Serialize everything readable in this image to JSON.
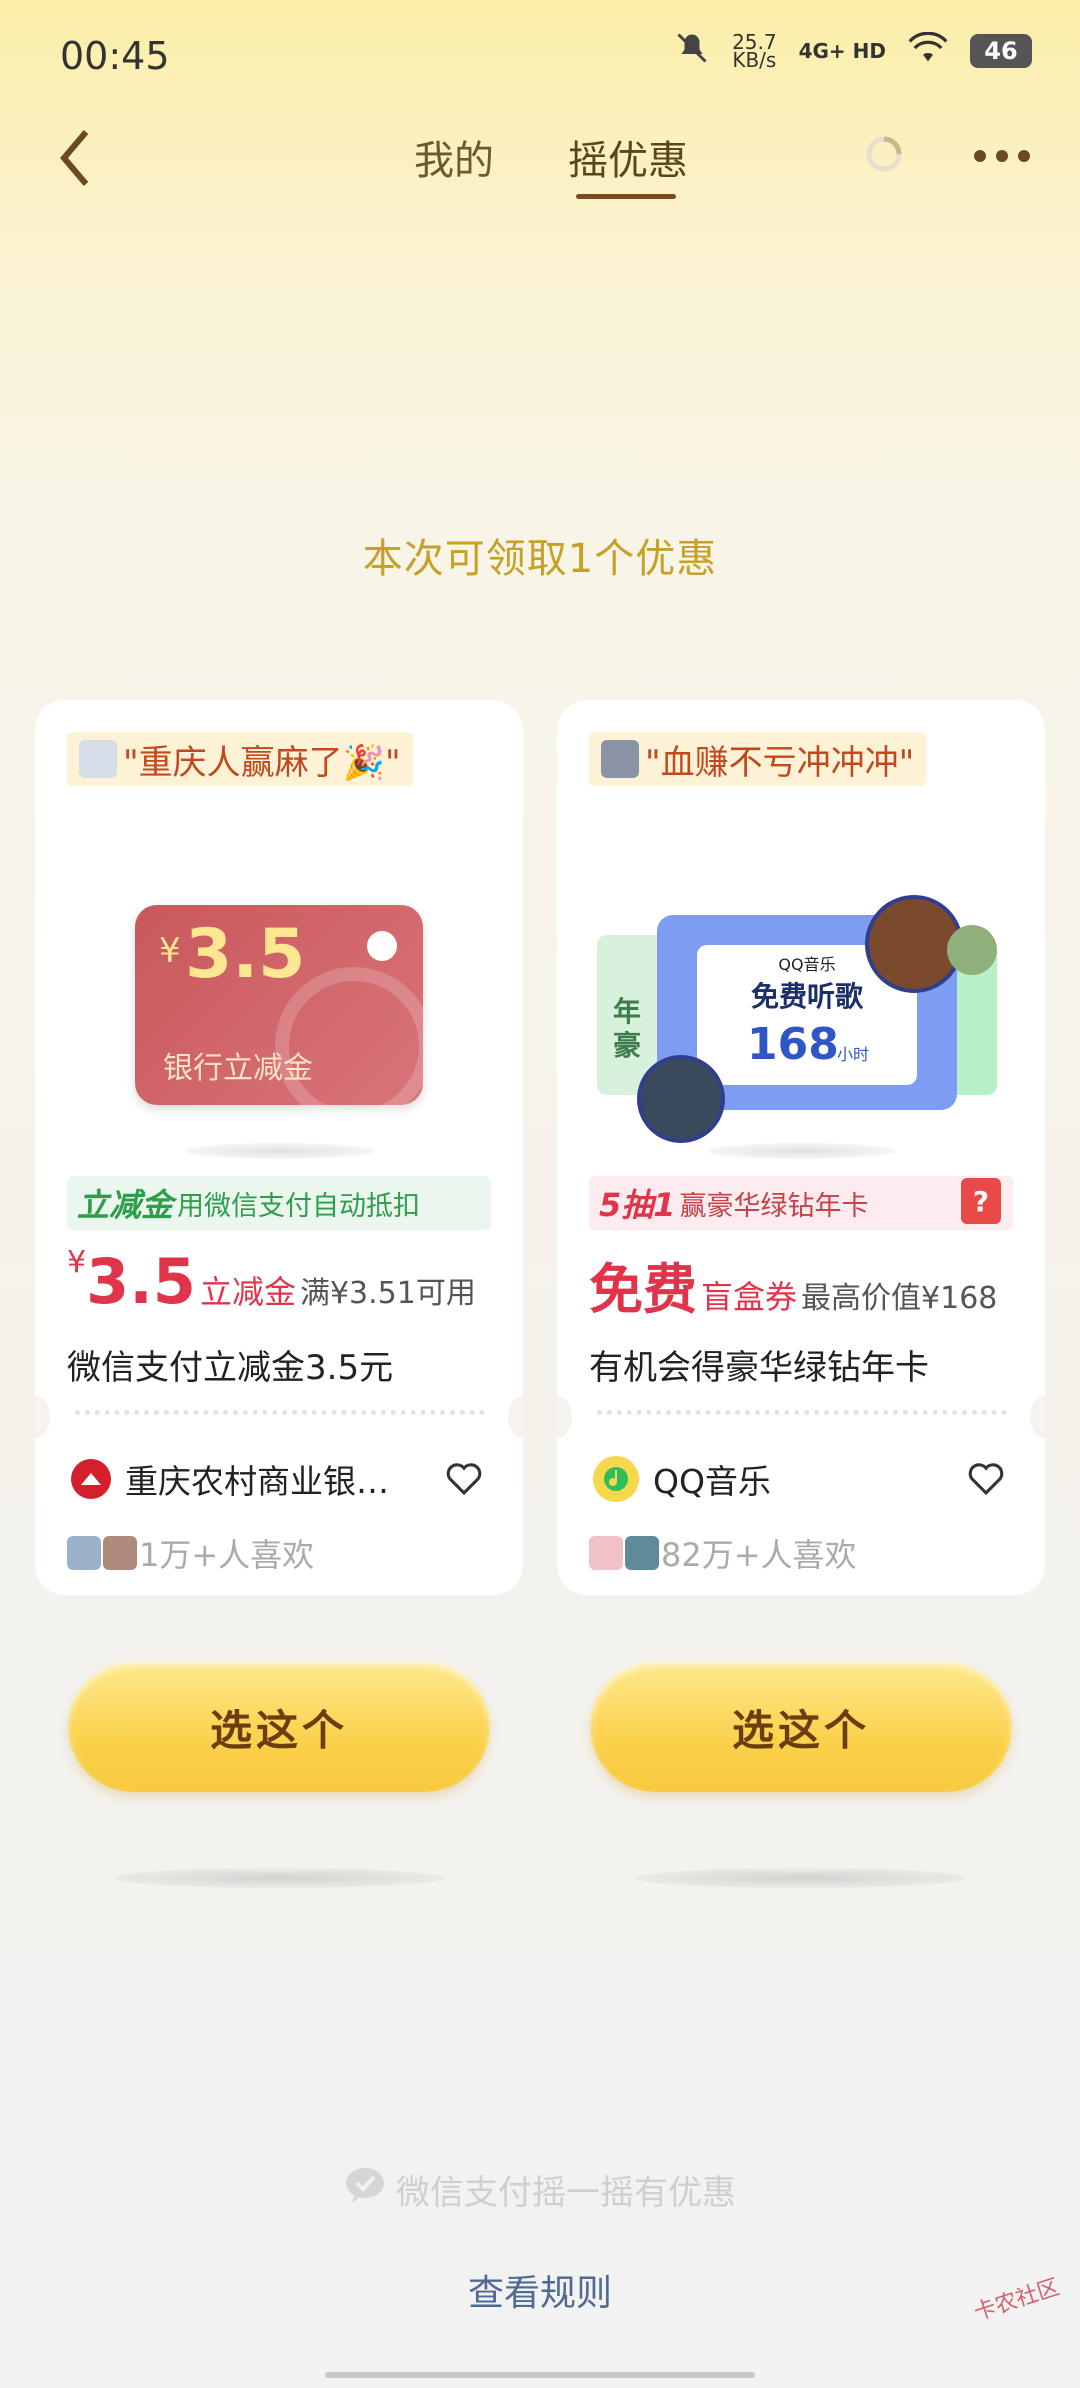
{
  "status_bar": {
    "time": "00:45",
    "net_speed_value": "25.7",
    "net_speed_unit": "KB/s",
    "network": "4G+ HD",
    "battery": "46"
  },
  "nav": {
    "tab_mine": "我的",
    "tab_shake": "摇优惠",
    "active_tab": "摇优惠"
  },
  "headline": "本次可领取1个优惠",
  "cards": [
    {
      "quote": "\"重庆人赢麻了🎉\"",
      "image": {
        "currency": "¥",
        "amount": "3.5",
        "label": "银行立减金"
      },
      "promo_strong": "立减金",
      "promo_text": "用微信支付自动抵扣",
      "price_symbol": "¥",
      "price_value": "3.5",
      "price_type": "立减金",
      "price_note": "满¥3.51可用",
      "title": "微信支付立减金3.5元",
      "brand": "重庆农村商业银…",
      "likes": "1万+人喜欢",
      "button": "选这个"
    },
    {
      "quote": "\"血赚不亏冲冲冲\"",
      "image": {
        "brand": "QQ音乐",
        "headline": "免费听歌",
        "hours": "168",
        "hours_unit": "小时",
        "side_text": "年豪"
      },
      "promo_strong": "5抽1",
      "promo_text": "赢豪华绿钻年卡",
      "price_value": "免费",
      "price_type": "盲盒券",
      "price_note": "最高价值¥168",
      "title": "有机会得豪华绿钻年卡",
      "brand": "QQ音乐",
      "likes": "82万+人喜欢",
      "button": "选这个"
    }
  ],
  "footer": {
    "brand_text": "微信支付摇一摇有优惠",
    "rules_link": "查看规则"
  },
  "watermark": "卡农社区",
  "colors": {
    "accent_gold": "#c7a126",
    "price_red": "#e0344a",
    "promo_green": "#2f9e4a",
    "promo_red": "#c84048",
    "button_yellow": "#fbd24d"
  }
}
